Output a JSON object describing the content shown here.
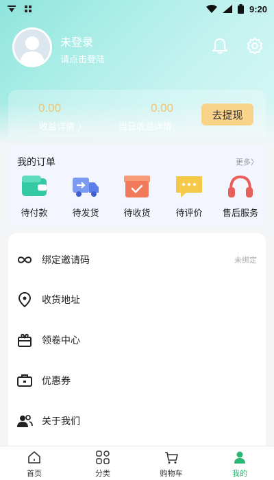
{
  "status_bar": {
    "time": "9:20"
  },
  "profile": {
    "name": "未登录",
    "hint": "请点击登陆"
  },
  "earnings": {
    "total_value": "0.00",
    "total_label": "收益详情 〉",
    "today_value": "0.00",
    "today_label": "当日收益详情",
    "withdraw_label": "去提现"
  },
  "orders": {
    "title": "我的订单",
    "more": "更多〉",
    "items": [
      {
        "label": "待付款",
        "icon": "wallet-icon",
        "color": "#35c9a3"
      },
      {
        "label": "待发货",
        "icon": "truck-icon",
        "color": "#6b8ef0"
      },
      {
        "label": "待收货",
        "icon": "box-icon",
        "color": "#f07a5a"
      },
      {
        "label": "待评价",
        "icon": "chat-icon",
        "color": "#f5c94a"
      },
      {
        "label": "售后服务",
        "icon": "headset-icon",
        "color": "#e8605c"
      }
    ]
  },
  "menu": [
    {
      "label": "绑定邀请码",
      "value": "未绑定",
      "icon": "infinity-icon"
    },
    {
      "label": "收货地址",
      "value": "",
      "icon": "location-icon"
    },
    {
      "label": "领卷中心",
      "value": "",
      "icon": "gift-icon"
    },
    {
      "label": "优惠券",
      "value": "",
      "icon": "coupon-icon"
    },
    {
      "label": "关于我们",
      "value": "",
      "icon": "people-icon"
    }
  ],
  "tabs": [
    {
      "label": "首页",
      "icon": "home-icon"
    },
    {
      "label": "分类",
      "icon": "category-icon"
    },
    {
      "label": "购物车",
      "icon": "cart-icon"
    },
    {
      "label": "我的",
      "icon": "user-icon"
    }
  ],
  "colors": {
    "accent_green": "#2bb673",
    "earn_value": "#f5c36b",
    "withdraw_bg": "#fad38a"
  }
}
